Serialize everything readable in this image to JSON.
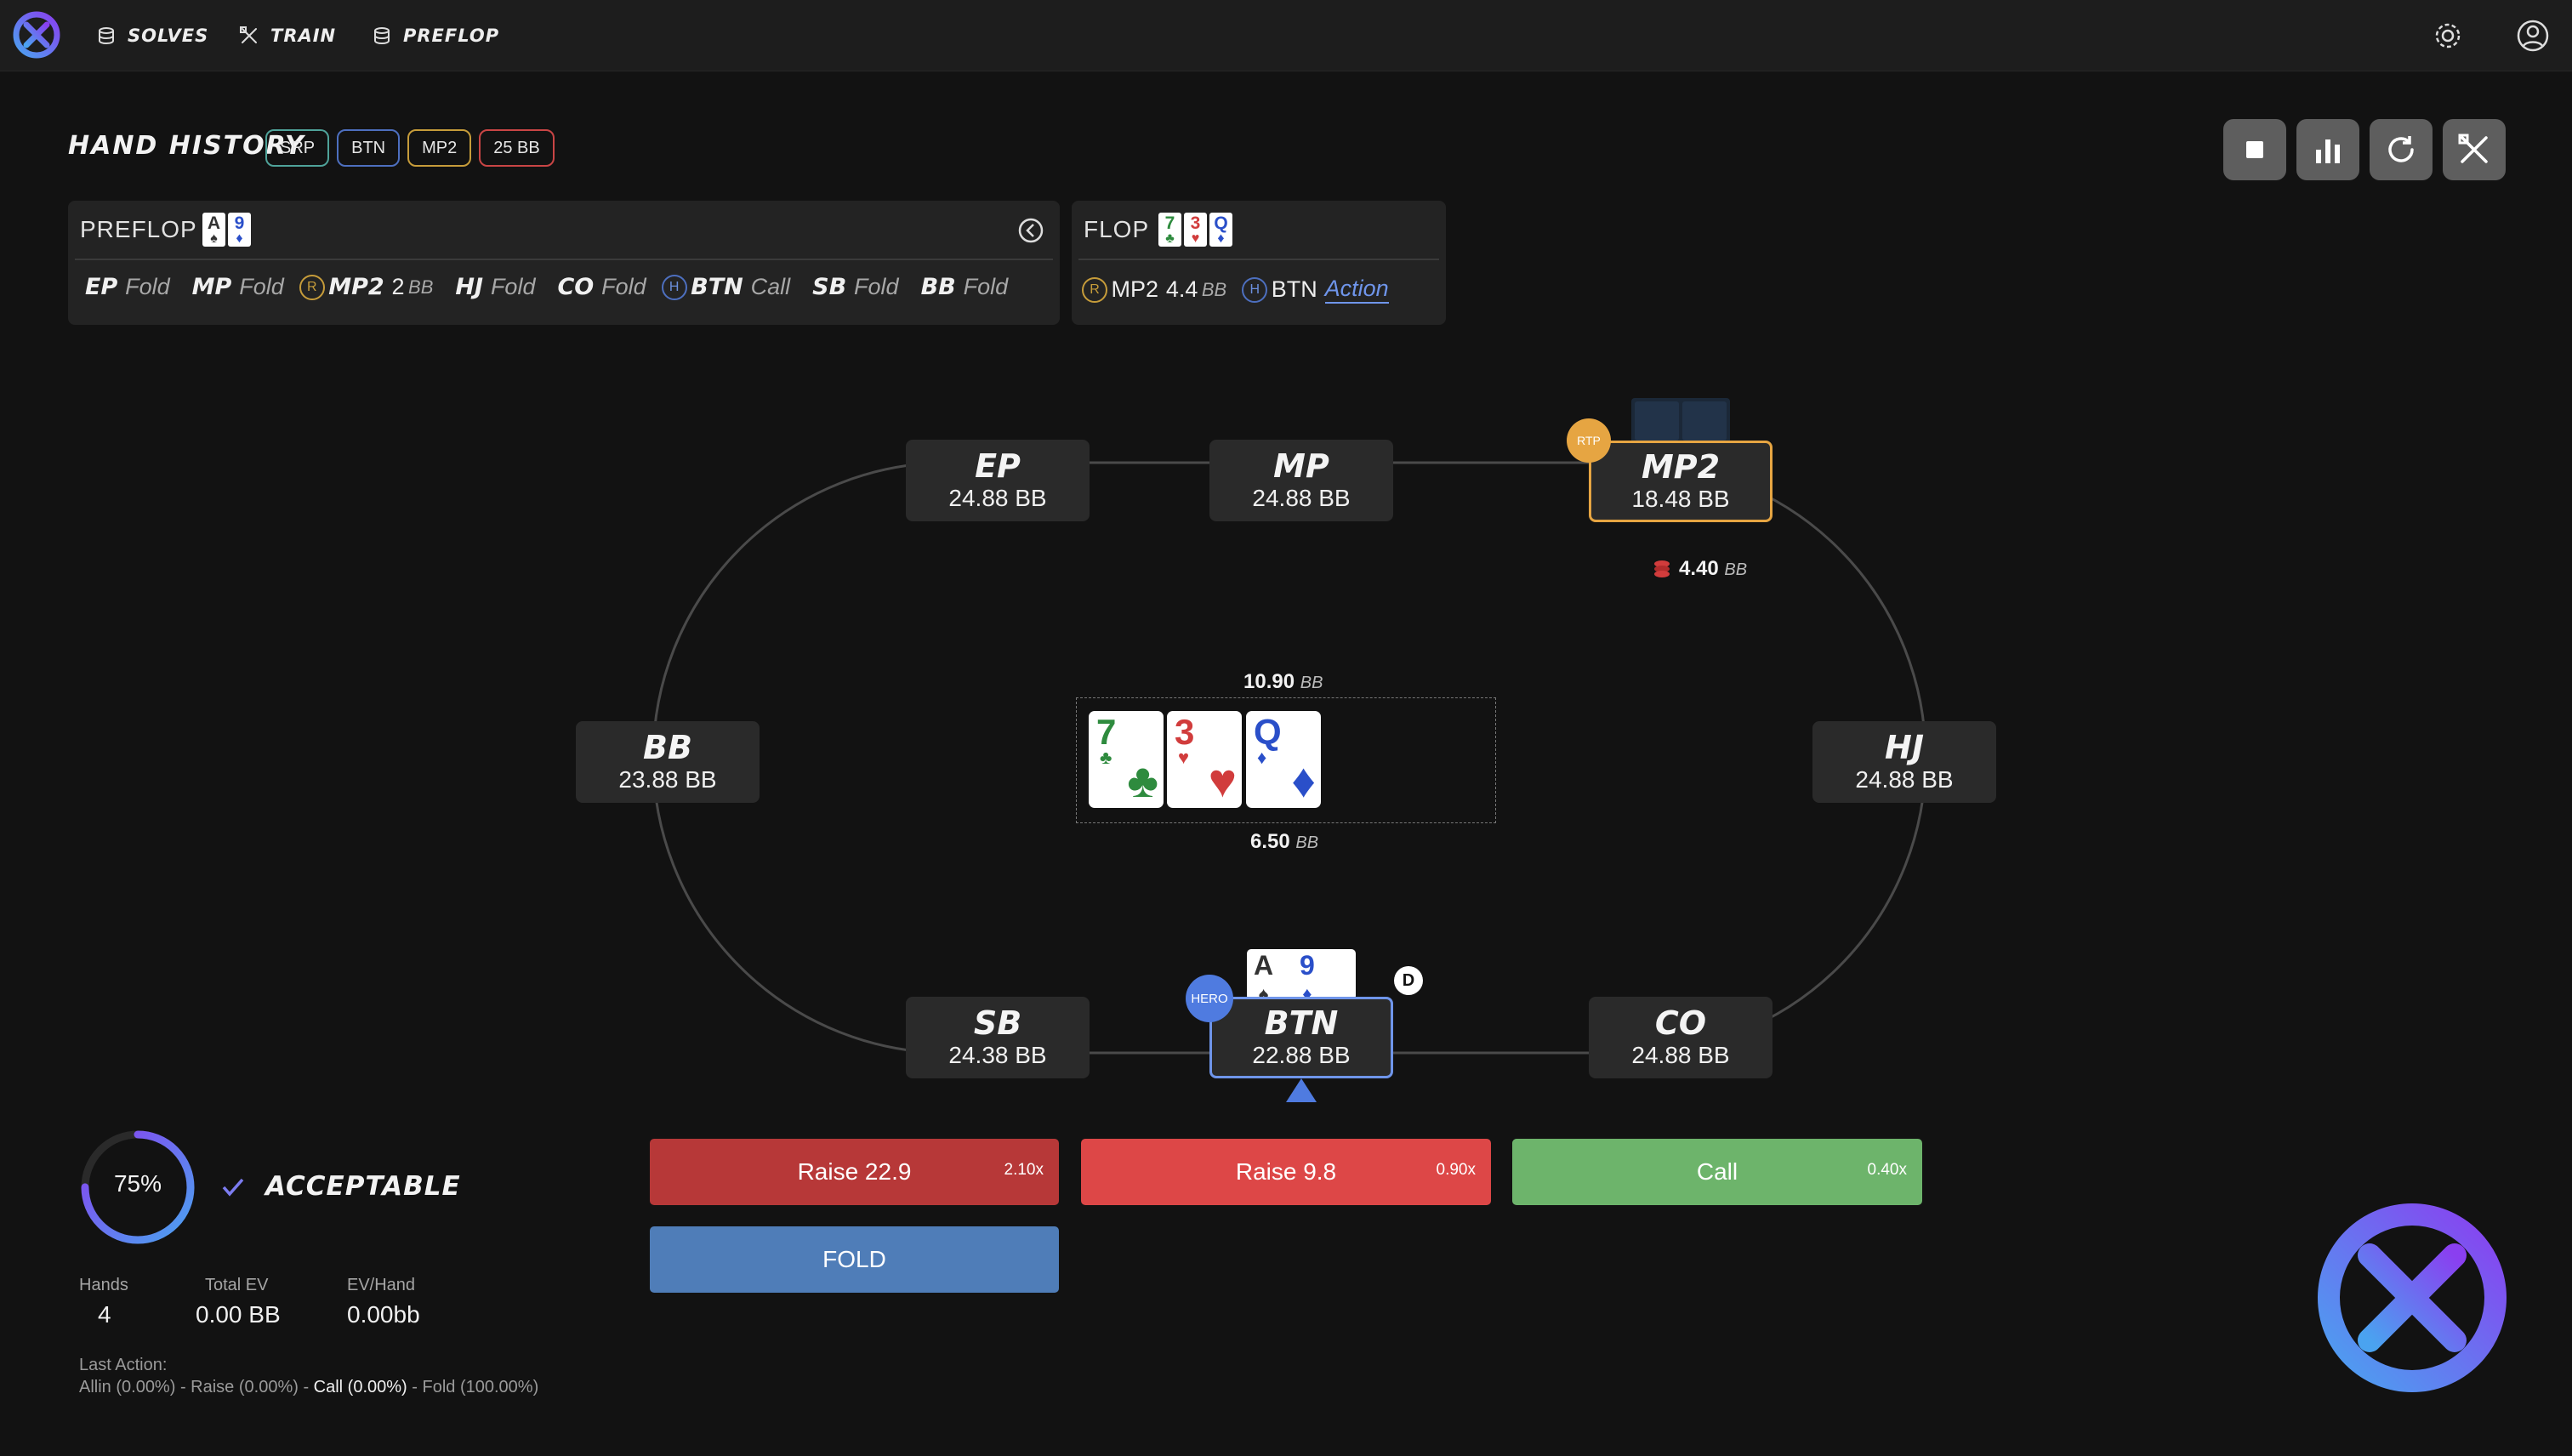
{
  "nav": {
    "items": [
      {
        "label": "SOLVES",
        "icon": "database-icon"
      },
      {
        "label": "TRAIN",
        "icon": "crossed-tools-icon"
      },
      {
        "label": "PREFLOP",
        "icon": "database-icon"
      }
    ],
    "right_icons": [
      "gear-icon",
      "user-icon"
    ]
  },
  "header": {
    "title": "HAND HISTORY",
    "tags": [
      {
        "label": "SRP",
        "color": "#4fa39a"
      },
      {
        "label": "BTN",
        "color": "#4d6fbf"
      },
      {
        "label": "MP2",
        "color": "#c69c3a"
      },
      {
        "label": "25 BB",
        "color": "#c94545"
      }
    ],
    "tool_icons": [
      "stop-icon",
      "bar-chart-icon",
      "refresh-icon",
      "crossed-tools-icon"
    ]
  },
  "preflop": {
    "title": "PREFLOP",
    "cards": [
      {
        "rank": "A",
        "suit": "♠",
        "color": "#333333"
      },
      {
        "rank": "9",
        "suit": "♦",
        "color": "#2a4fc9"
      }
    ],
    "actions": [
      {
        "pos": "EP",
        "action": "Fold"
      },
      {
        "pos": "MP",
        "action": "Fold"
      },
      {
        "badge": "R",
        "pos": "MP2",
        "amount": "2",
        "unit": "BB"
      },
      {
        "pos": "HJ",
        "action": "Fold"
      },
      {
        "pos": "CO",
        "action": "Fold"
      },
      {
        "badge": "H",
        "pos": "BTN",
        "action": "Call"
      },
      {
        "pos": "SB",
        "action": "Fold"
      },
      {
        "pos": "BB",
        "action": "Fold"
      }
    ]
  },
  "flop": {
    "title": "FLOP",
    "cards": [
      {
        "rank": "7",
        "suit": "♣",
        "color": "#2e8b3e"
      },
      {
        "rank": "3",
        "suit": "♥",
        "color": "#d13c3c"
      },
      {
        "rank": "Q",
        "suit": "♦",
        "color": "#2a4fc9"
      }
    ],
    "line": {
      "r_badge": "R",
      "r_pos": "MP2",
      "r_amount": "4.4",
      "unit": "BB",
      "h_badge": "H",
      "h_pos": "BTN",
      "action_link": "Action"
    }
  },
  "table": {
    "seats": {
      "EP": {
        "name": "EP",
        "stack": "24.88 BB"
      },
      "MP": {
        "name": "MP",
        "stack": "24.88 BB"
      },
      "MP2": {
        "name": "MP2",
        "stack": "18.48 BB"
      },
      "BB": {
        "name": "BB",
        "stack": "23.88 BB"
      },
      "HJ": {
        "name": "HJ",
        "stack": "24.88 BB"
      },
      "SB": {
        "name": "SB",
        "stack": "24.38 BB"
      },
      "BTN": {
        "name": "BTN",
        "stack": "22.88 BB"
      },
      "CO": {
        "name": "CO",
        "stack": "24.88 BB"
      }
    },
    "rtp_badge": "RTP",
    "hero_badge": "HERO",
    "dealer_badge": "D",
    "mp2_bet": {
      "amount": "4.40",
      "unit": "BB"
    },
    "pot_top": {
      "amount": "10.90",
      "unit": "BB"
    },
    "pot_bottom": {
      "amount": "6.50",
      "unit": "BB"
    },
    "hero_cards": [
      {
        "rank": "A",
        "suit": "♠",
        "color": "#333333"
      },
      {
        "rank": "9",
        "suit": "♦",
        "color": "#2a4fc9"
      }
    ],
    "board": [
      {
        "rank": "7",
        "suit": "♣",
        "color": "#2e8b3e"
      },
      {
        "rank": "3",
        "suit": "♥",
        "color": "#d13c3c"
      },
      {
        "rank": "Q",
        "suit": "♦",
        "color": "#2a4fc9"
      }
    ]
  },
  "actions": {
    "raise_big": {
      "label": "Raise 22.9",
      "freq": "2.10x",
      "color": "#b73838"
    },
    "raise_small": {
      "label": "Raise 9.8",
      "freq": "0.90x",
      "color": "#dd4747"
    },
    "call": {
      "label": "Call",
      "freq": "0.40x",
      "color": "#6db46b"
    },
    "fold": {
      "label": "FOLD",
      "color": "#4f7db8"
    }
  },
  "result": {
    "score": "75%",
    "score_fraction": 0.75,
    "verdict": "ACCEPTABLE"
  },
  "stats": {
    "hands_label": "Hands",
    "hands": "4",
    "total_ev_label": "Total EV",
    "total_ev": "0.00 BB",
    "ev_hand_label": "EV/Hand",
    "ev_hand": "0.00bb"
  },
  "last_action": {
    "label": "Last Action:",
    "allin": "Allin (0.00%)",
    "raise": "Raise (0.00%)",
    "call": "Call (0.00%)",
    "fold": "Fold (100.00%)",
    "sep": " - "
  }
}
